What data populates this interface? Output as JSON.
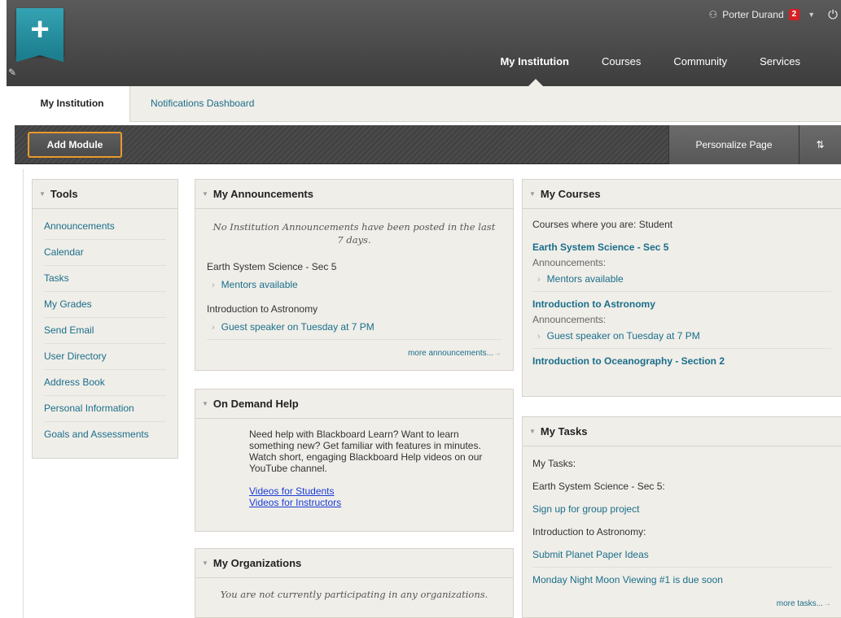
{
  "header": {
    "user_name": "Porter Durand",
    "notification_count": "2",
    "nav": [
      "My Institution",
      "Courses",
      "Community",
      "Services"
    ],
    "active_nav": "My Institution"
  },
  "subtabs": {
    "active": "My Institution",
    "other": "Notifications Dashboard"
  },
  "toolbar": {
    "add_module": "Add Module",
    "personalize": "Personalize Page",
    "reorder_glyph": "⇅"
  },
  "tools": {
    "title": "Tools",
    "items": [
      "Announcements",
      "Calendar",
      "Tasks",
      "My Grades",
      "Send Email",
      "User Directory",
      "Address Book",
      "Personal Information",
      "Goals and Assessments"
    ]
  },
  "announcements": {
    "title": "My Announcements",
    "no_institution": "No Institution Announcements have been posted in the last 7 days.",
    "groups": [
      {
        "course": "Earth System Science - Sec 5",
        "item": "Mentors available"
      },
      {
        "course": "Introduction to Astronomy",
        "item": "Guest speaker on Tuesday at 7 PM"
      }
    ],
    "more": "more announcements..."
  },
  "help": {
    "title": "On Demand Help",
    "text": "Need help with Blackboard Learn? Want to learn something new? Get familiar with features in minutes. Watch short, engaging Blackboard Help videos on our YouTube channel.",
    "link_students": "Videos for Students",
    "link_instructors": "Videos for Instructors"
  },
  "organizations": {
    "title": "My Organizations",
    "text": "You are not currently participating in any organizations."
  },
  "courses": {
    "title": "My Courses",
    "intro": "Courses where you are: Student",
    "ann_label": "Announcements:",
    "list": [
      {
        "name": "Earth System Science - Sec 5",
        "announcement": "Mentors available"
      },
      {
        "name": "Introduction to Astronomy",
        "announcement": "Guest speaker on Tuesday at 7 PM"
      },
      {
        "name": "Introduction to Oceanography - Section 2"
      }
    ]
  },
  "tasks": {
    "title": "My Tasks",
    "intro": "My Tasks:",
    "course1": "Earth System Science - Sec 5:",
    "task1": "Sign up for group project",
    "course2": "Introduction to Astronomy:",
    "task2": "Submit Planet Paper Ideas",
    "task3": "Monday Night Moon Viewing #1 is due soon",
    "more": "more tasks..."
  }
}
